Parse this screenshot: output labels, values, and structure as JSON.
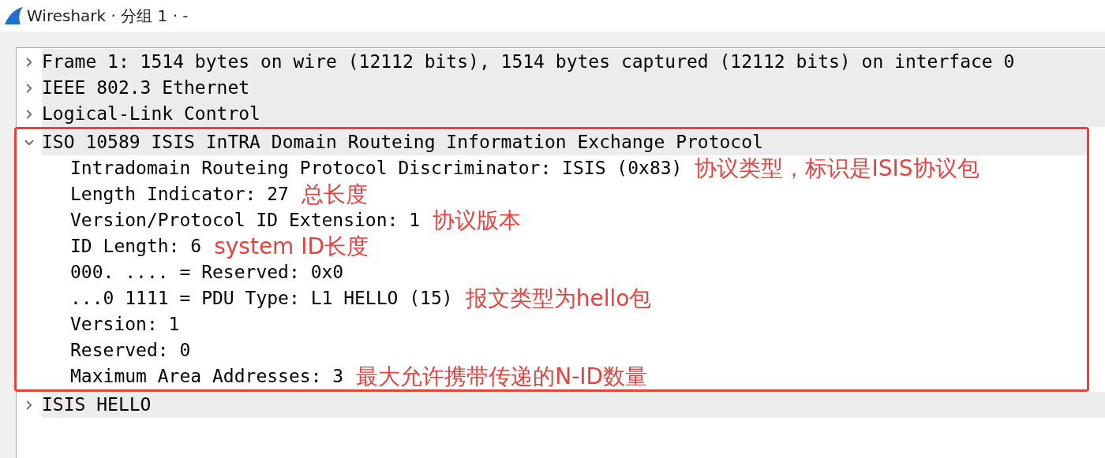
{
  "window": {
    "title": "Wireshark · 分组 1 · -"
  },
  "tree": [
    {
      "label": "Frame 1: 1514 bytes on wire (12112 bits), 1514 bytes captured (12112 bits) on interface 0",
      "expanded": false,
      "highlighted": false
    },
    {
      "label": "IEEE 802.3 Ethernet",
      "expanded": false,
      "highlighted": false
    },
    {
      "label": "Logical-Link Control",
      "expanded": false,
      "highlighted": false
    },
    {
      "label": "ISO 10589 ISIS InTRA Domain Routeing Information Exchange Protocol",
      "expanded": true,
      "highlighted": true,
      "children": [
        {
          "label": "Intradomain Routeing Protocol Discriminator: ISIS (0x83)",
          "note": "协议类型，标识是ISIS协议包"
        },
        {
          "label": "Length Indicator: 27",
          "note": "总长度"
        },
        {
          "label": "Version/Protocol ID Extension: 1",
          "note": "协议版本"
        },
        {
          "label": "ID Length: 6",
          "note": "system ID长度"
        },
        {
          "label": "000. .... = Reserved: 0x0"
        },
        {
          "label": "...0 1111 = PDU Type: L1 HELLO (15)",
          "note": "报文类型为hello包"
        },
        {
          "label": "Version: 1"
        },
        {
          "label": "Reserved: 0"
        },
        {
          "label": "Maximum Area Addresses: 3",
          "note": "最大允许携带传递的N-ID数量"
        }
      ]
    },
    {
      "label": "ISIS HELLO",
      "expanded": false,
      "highlighted": false
    }
  ]
}
